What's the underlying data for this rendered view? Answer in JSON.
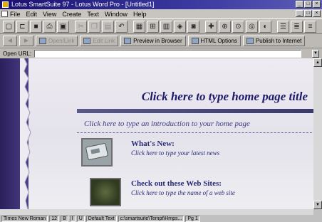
{
  "window": {
    "title": "Lotus SmartSuite 97 - Lotus Word Pro - [Untitled1]"
  },
  "menu": [
    "File",
    "Edit",
    "View",
    "Create",
    "Text",
    "Window",
    "Help"
  ],
  "web_toolbar": {
    "back_label": "◄",
    "forward_label": "►",
    "btn_disabled_1": "Open/Link",
    "btn_disabled_2": "Edit Link",
    "preview": "Preview in Browser",
    "html_options": "HTML Options",
    "publish": "Publish to Internet"
  },
  "url": {
    "label": "Open URL:",
    "value": ""
  },
  "document": {
    "title_placeholder": "Click here to type home page title",
    "intro_placeholder": "Click here to type an introduction to your home page",
    "section1": {
      "title": "What's New:",
      "subtitle": "Click here to type your latest news"
    },
    "section2": {
      "title": "Check out these Web Sites:",
      "subtitle": "Click here to type the name of a web site"
    }
  },
  "status": {
    "font": "Times New Roman",
    "size": "12",
    "style": "Default Text",
    "path": "c:\\smartsuite\\Tempt\\Hmps...",
    "page": "Pg 1"
  },
  "colors": {
    "title_blue": "#1e1a6a",
    "band_purple": "#2c1f5c",
    "bg": "#eeeaf2"
  }
}
